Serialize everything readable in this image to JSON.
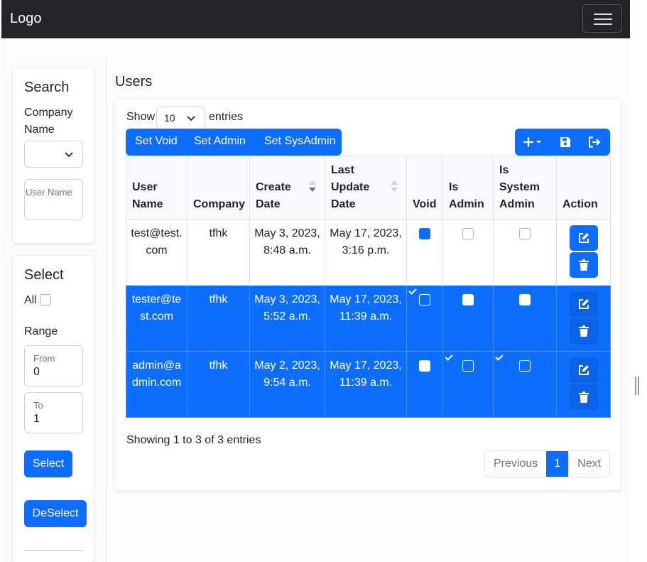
{
  "navbar": {
    "logo": "Logo"
  },
  "sidebar": {
    "search": {
      "heading": "Search",
      "company_label": "Company Name",
      "username_placeholder": "User Name"
    },
    "select": {
      "heading": "Select",
      "all_label": "All",
      "range_label": "Range",
      "from_label": "From",
      "from_value": "0",
      "to_label": "To",
      "to_value": "1",
      "select_button": "Select",
      "deselect_button": "DeSelect"
    }
  },
  "main": {
    "title": "Users",
    "show_label": "Show",
    "entries_label": "entries",
    "page_length": "10",
    "actions": {
      "set_void": "Set Void",
      "set_admin": "Set Admin",
      "set_sysadmin": "Set SysAdmin"
    },
    "columns": {
      "user_name": "User Name",
      "company": "Company",
      "create_date": "Create Date",
      "last_update": "Last Update Date",
      "void": "Void",
      "is_admin": "Is Admin",
      "is_sys_admin": "Is System Admin",
      "action": "Action"
    },
    "rows": [
      {
        "user": "test@test.com",
        "company": "tfhk",
        "created": "May 3, 2023, 8:48 a.m.",
        "updated": "May 17, 2023, 3:16 p.m.",
        "void": true,
        "admin": false,
        "sysadmin": false,
        "selected": false
      },
      {
        "user": "tester@test.com",
        "company": "tfhk",
        "created": "May 3, 2023, 5:52 a.m.",
        "updated": "May 17, 2023, 11:39 a.m.",
        "void": true,
        "admin": false,
        "sysadmin": false,
        "selected": true
      },
      {
        "user": "admin@admin.com",
        "company": "tfhk",
        "created": "May 2, 2023, 9:54 a.m.",
        "updated": "May 17, 2023, 11:39 a.m.",
        "void": false,
        "admin": true,
        "sysadmin": true,
        "selected": true
      }
    ],
    "info": "Showing 1 to 3 of 3 entries",
    "pagination": {
      "previous": "Previous",
      "page": "1",
      "next": "Next"
    }
  },
  "colors": {
    "primary": "#0d6efd",
    "navbar": "#212529"
  }
}
